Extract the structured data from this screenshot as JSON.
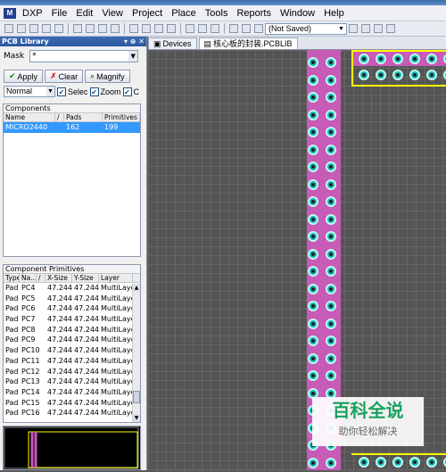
{
  "menu": [
    "File",
    "Edit",
    "View",
    "Project",
    "Place",
    "Tools",
    "Reports",
    "Window",
    "Help"
  ],
  "app_logo": "DXP",
  "toolbar": {
    "saved_state": "(Not Saved)"
  },
  "panel": {
    "title": "PCB Library",
    "mask_label": "Mask",
    "mask_value": "*",
    "apply": "Apply",
    "clear": "Clear",
    "magnify": "Magnify",
    "mode": "Normal",
    "select_label": "Selec",
    "zoom_label": "Zoom",
    "clear2_label": "C"
  },
  "components": {
    "label": "Components",
    "headers": [
      "Name",
      "/",
      "Pads",
      "Primitives"
    ],
    "rows": [
      {
        "name": "MICRO2440",
        "pads": "162",
        "primitives": "199"
      }
    ]
  },
  "primitives": {
    "label": "Component Primitives",
    "headers": [
      "Type",
      "Na...",
      "/",
      "X-Size",
      "Y-Size",
      "Layer"
    ],
    "rows": [
      {
        "type": "Pad",
        "name": "PC4",
        "x": "47.244n",
        "y": "47.244n",
        "layer": "MultiLaye"
      },
      {
        "type": "Pad",
        "name": "PC5",
        "x": "47.244n",
        "y": "47.244n",
        "layer": "MultiLaye"
      },
      {
        "type": "Pad",
        "name": "PC6",
        "x": "47.244n",
        "y": "47.244n",
        "layer": "MultiLaye"
      },
      {
        "type": "Pad",
        "name": "PC7",
        "x": "47.244n",
        "y": "47.244n",
        "layer": "MultiLaye"
      },
      {
        "type": "Pad",
        "name": "PC8",
        "x": "47.244n",
        "y": "47.244n",
        "layer": "MultiLaye"
      },
      {
        "type": "Pad",
        "name": "PC9",
        "x": "47.244n",
        "y": "47.244n",
        "layer": "MultiLaye"
      },
      {
        "type": "Pad",
        "name": "PC10",
        "x": "47.244n",
        "y": "47.244n",
        "layer": "MultiLaye"
      },
      {
        "type": "Pad",
        "name": "PC11",
        "x": "47.244n",
        "y": "47.244n",
        "layer": "MultiLaye"
      },
      {
        "type": "Pad",
        "name": "PC12",
        "x": "47.244n",
        "y": "47.244n",
        "layer": "MultiLaye"
      },
      {
        "type": "Pad",
        "name": "PC13",
        "x": "47.244n",
        "y": "47.244n",
        "layer": "MultiLaye"
      },
      {
        "type": "Pad",
        "name": "PC14",
        "x": "47.244n",
        "y": "47.244n",
        "layer": "MultiLaye"
      },
      {
        "type": "Pad",
        "name": "PC15",
        "x": "47.244n",
        "y": "47.244n",
        "layer": "MultiLaye"
      },
      {
        "type": "Pad",
        "name": "PC16",
        "x": "47.244n",
        "y": "47.244n",
        "layer": "MultiLaye"
      }
    ]
  },
  "tabs": [
    {
      "label": "Devices"
    },
    {
      "label": "核心板的封装.PCBLIB"
    }
  ],
  "watermark": {
    "line1": "百科全说",
    "line2": "助你轻松解决"
  }
}
